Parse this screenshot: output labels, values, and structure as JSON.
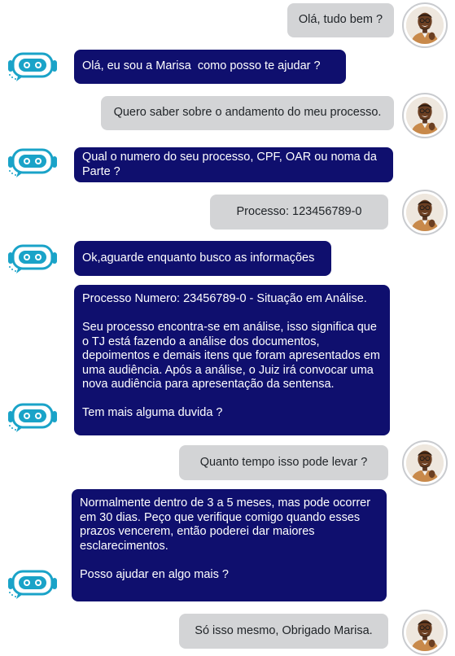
{
  "messages": [
    {
      "sender": "user",
      "text": "Olá, tudo bem ?"
    },
    {
      "sender": "bot",
      "text": "Olá, eu sou a Marisa  como posso te ajudar ?"
    },
    {
      "sender": "user",
      "text": "Quero saber sobre o andamento do meu processo."
    },
    {
      "sender": "bot",
      "text": "Qual o numero do seu processo, CPF, OAR ou noma da Parte ?"
    },
    {
      "sender": "user",
      "text": "Processo: 123456789-0"
    },
    {
      "sender": "bot",
      "text": "Ok,aguarde enquanto busco as informações"
    },
    {
      "sender": "bot",
      "text": "Processo Numero: 23456789-0 - Situação em Análise.\n\nSeu processo encontra-se em análise, isso significa que o TJ está fazendo a análise dos documentos, depoimentos e demais itens que foram apresentados em uma audiência. Após a análise, o Juiz irá convocar uma nova audiência para apresentação da sentensa.\n\nTem mais alguma duvida ?"
    },
    {
      "sender": "user",
      "text": "Quanto tempo isso pode levar ?"
    },
    {
      "sender": "bot",
      "text": "Normalmente dentro de 3 a 5 meses, mas pode ocorrer em 30 dias. Peço que verifique comigo quando esses prazos vencerem, então poderei dar maiores esclarecimentos.\n\nPosso ajudar en algo mais ?"
    },
    {
      "sender": "user",
      "text": "Só isso mesmo, Obrigado Marisa."
    }
  ],
  "colors": {
    "bot_bubble": "#0f0f6e",
    "user_bubble": "#d3d4d6",
    "bot_icon": "#1aa3c8"
  },
  "icons": {
    "user_avatar": "user-avatar-photo",
    "bot_avatar": "robot-chat-icon"
  }
}
